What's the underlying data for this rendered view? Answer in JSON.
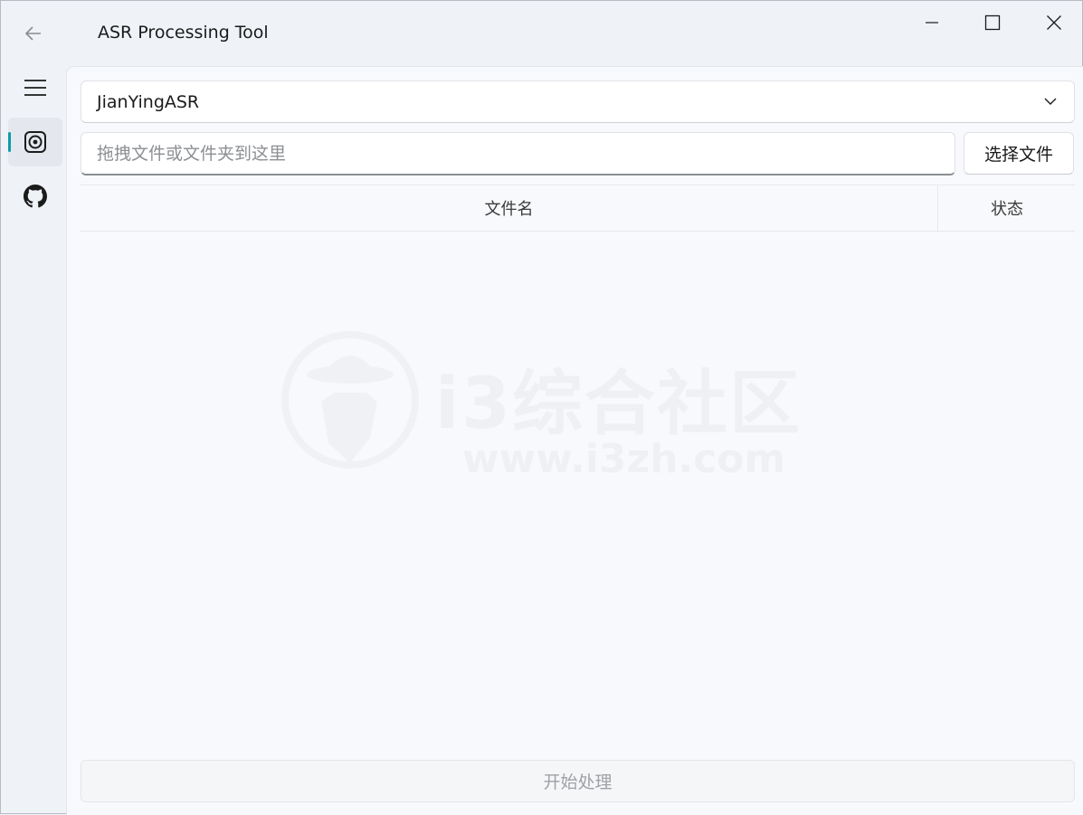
{
  "window": {
    "title": "ASR Processing Tool"
  },
  "nav": {
    "items": [
      {
        "name": "menu",
        "icon": "hamburger-menu-icon"
      },
      {
        "name": "asr",
        "icon": "target-icon",
        "active": true
      },
      {
        "name": "github",
        "icon": "github-icon"
      }
    ],
    "accent": "#0f9ba5"
  },
  "main": {
    "asr_select": {
      "value": "JianYingASR"
    },
    "file_input": {
      "placeholder": "拖拽文件或文件夹到这里",
      "value": ""
    },
    "choose_button": "选择文件",
    "table": {
      "columns": [
        "文件名",
        "状态"
      ],
      "rows": []
    },
    "start_button": "开始处理"
  },
  "watermark": {
    "brand": "i3综合社区",
    "url": "www.i3zh.com"
  }
}
